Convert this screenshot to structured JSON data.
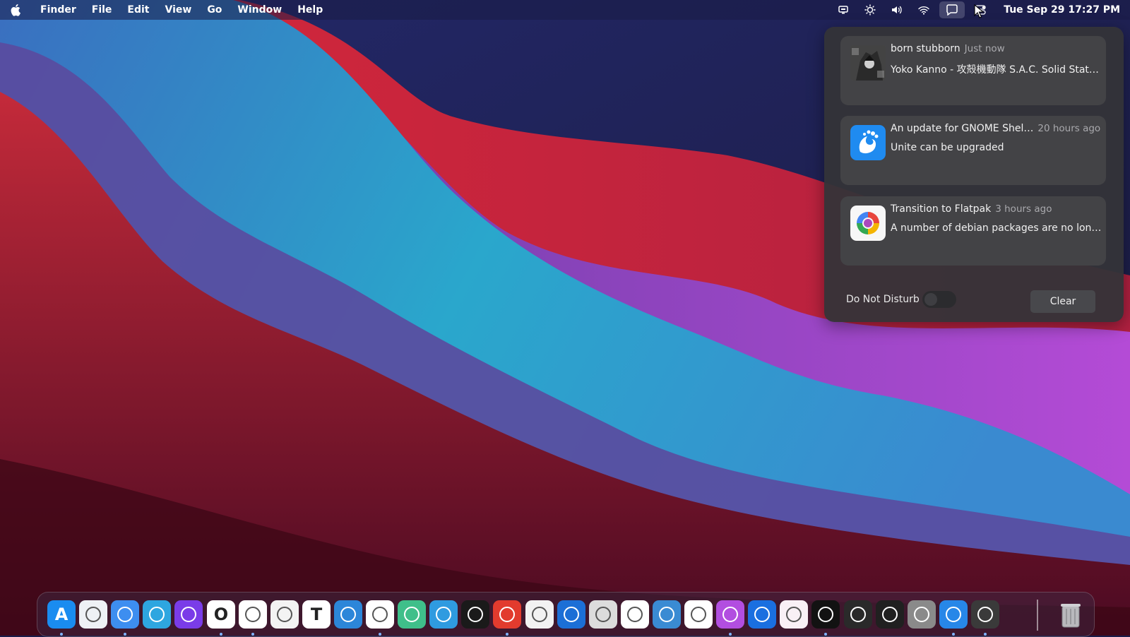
{
  "menubar": {
    "app_name": "Finder",
    "menus": [
      "File",
      "Edit",
      "View",
      "Go",
      "Window",
      "Help"
    ],
    "clock": "Tue Sep 29  17:27 PM",
    "tray_icons": [
      "screen-icon",
      "brightness-icon",
      "volume-icon",
      "wifi-icon",
      "notifications-icon",
      "control-center-icon"
    ]
  },
  "notifications": [
    {
      "title": "born stubborn",
      "time": "Just now",
      "body": "Yoko Kanno - 攻殻機動隊 S.A.C. Solid State Society O.S.T.",
      "icon": "album-art-icon"
    },
    {
      "title": "An update for GNOME Shel…",
      "time": "20 hours ago",
      "body": "Unite can be upgraded",
      "icon": "gnome-software-icon"
    },
    {
      "title": "Transition to Flatpak",
      "time": "3 hours ago",
      "body": "A number of debian packages are no longer required",
      "icon": "flatpak-transition-icon"
    }
  ],
  "panel": {
    "dnd_label": "Do Not Disturb",
    "dnd_enabled": false,
    "clear_label": "Clear"
  },
  "dock": {
    "apps": [
      {
        "name": "app-store",
        "color": "#1a8cf0",
        "glyph": "A",
        "running": true
      },
      {
        "name": "launchpad",
        "color": "#eef1f5",
        "glyph": "",
        "running": false
      },
      {
        "name": "finder",
        "color": "#3d8ef0",
        "glyph": "",
        "running": true
      },
      {
        "name": "telegram",
        "color": "#2ea6e0",
        "glyph": "",
        "running": false
      },
      {
        "name": "firefox",
        "color": "#7a3ce8",
        "glyph": "",
        "running": false
      },
      {
        "name": "opera",
        "color": "#ffffff",
        "glyph": "O",
        "running": true
      },
      {
        "name": "brave",
        "color": "#ffffff",
        "glyph": "",
        "running": true
      },
      {
        "name": "text-editor",
        "color": "#f3f3f3",
        "glyph": "",
        "running": false
      },
      {
        "name": "typora",
        "color": "#ffffff",
        "glyph": "T",
        "running": false
      },
      {
        "name": "xcode",
        "color": "#2c86d9",
        "glyph": "",
        "running": false
      },
      {
        "name": "vscode",
        "color": "#ffffff",
        "glyph": "",
        "running": true
      },
      {
        "name": "atom",
        "color": "#3fbf8a",
        "glyph": "",
        "running": false
      },
      {
        "name": "gnome-tweaks",
        "color": "#2f9be0",
        "glyph": "",
        "running": false
      },
      {
        "name": "dashboard",
        "color": "#1a1a1a",
        "glyph": "",
        "running": false
      },
      {
        "name": "safari",
        "color": "#e23b2e",
        "glyph": "",
        "running": true
      },
      {
        "name": "chrome",
        "color": "#f2f2f2",
        "glyph": "",
        "running": false
      },
      {
        "name": "document-viewer",
        "color": "#1c6fd6",
        "glyph": "",
        "running": false
      },
      {
        "name": "preview",
        "color": "#dcdcdc",
        "glyph": "",
        "running": false
      },
      {
        "name": "sketch",
        "color": "#ffffff",
        "glyph": "",
        "running": false
      },
      {
        "name": "image-capture",
        "color": "#3a8bd3",
        "glyph": "",
        "running": false
      },
      {
        "name": "screenshot",
        "color": "#ffffff",
        "glyph": "",
        "running": false
      },
      {
        "name": "screen-recorder",
        "color": "#b24ee0",
        "glyph": "",
        "running": true
      },
      {
        "name": "quicktime",
        "color": "#1a6fe0",
        "glyph": "",
        "running": false
      },
      {
        "name": "music-player",
        "color": "#f9f0f6",
        "glyph": "",
        "running": false
      },
      {
        "name": "spotify",
        "color": "#121212",
        "glyph": "",
        "running": true
      },
      {
        "name": "activity-monitor",
        "color": "#2a2a2a",
        "glyph": "",
        "running": false
      },
      {
        "name": "terminal",
        "color": "#202020",
        "glyph": "",
        "running": false
      },
      {
        "name": "extensions",
        "color": "#8a8a8a",
        "glyph": "",
        "running": false
      },
      {
        "name": "gnome-software",
        "color": "#2787e8",
        "glyph": "",
        "running": true
      },
      {
        "name": "system-preferences",
        "color": "#3a3a3a",
        "glyph": "",
        "running": true
      }
    ],
    "trash": {
      "name": "trash"
    }
  }
}
